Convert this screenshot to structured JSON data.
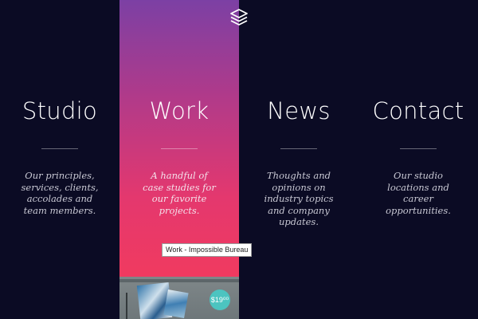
{
  "nav": {
    "columns": [
      {
        "title": "Studio",
        "description": "Our principles, services, clients, accolades and team members."
      },
      {
        "title": "Work",
        "description": "A handful of case studies for our favorite projects."
      },
      {
        "title": "News",
        "description": "Thoughts and opinions on industry topics and company updates."
      },
      {
        "title": "Contact",
        "description": "Our studio locations and career opportunities."
      }
    ]
  },
  "tooltip": {
    "text": "Work - Impossible Bureau"
  },
  "preview": {
    "price": "$19⁰⁰"
  },
  "logo": {
    "icon": "stacked-layers-icon"
  },
  "colors": {
    "background": "#0b0b24",
    "gradient_top": "#7c40a4",
    "gradient_bottom": "#ef3b62",
    "badge": "#4cc4c0"
  }
}
